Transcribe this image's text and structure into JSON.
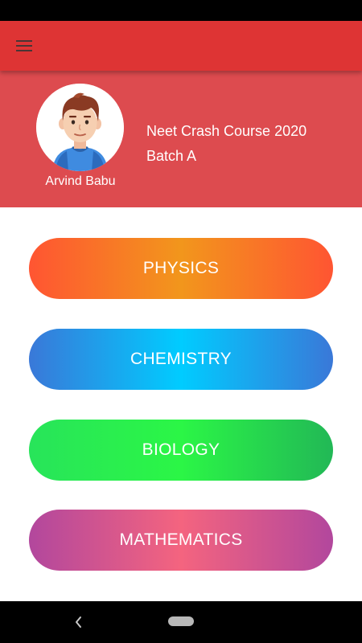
{
  "app_bar": {
    "menu_icon": "hamburger-menu-icon"
  },
  "profile": {
    "user_name": "Arvind Babu",
    "avatar_icon": "user-avatar-icon",
    "course_name": "Neet Crash Course 2020",
    "batch": "Batch A"
  },
  "subjects": [
    {
      "label": "PHYSICS",
      "colors": [
        "#ff5532",
        "#f2961c",
        "#ff5532"
      ]
    },
    {
      "label": "CHEMISTRY",
      "colors": [
        "#3a78d8",
        "#00ccff",
        "#3a78d8"
      ]
    },
    {
      "label": "BIOLOGY",
      "colors": [
        "#28e45a",
        "#2bf646",
        "#22b856"
      ]
    },
    {
      "label": "MATHEMATICS",
      "colors": [
        "#b2479d",
        "#f4647f",
        "#b2479d"
      ]
    }
  ],
  "system_nav": {
    "back_icon": "back-chevron-icon",
    "home_icon": "home-pill-icon"
  },
  "colors": {
    "app_bar": "#de3434",
    "profile_panel": "#dd4b4f",
    "status_bar": "#000000"
  }
}
